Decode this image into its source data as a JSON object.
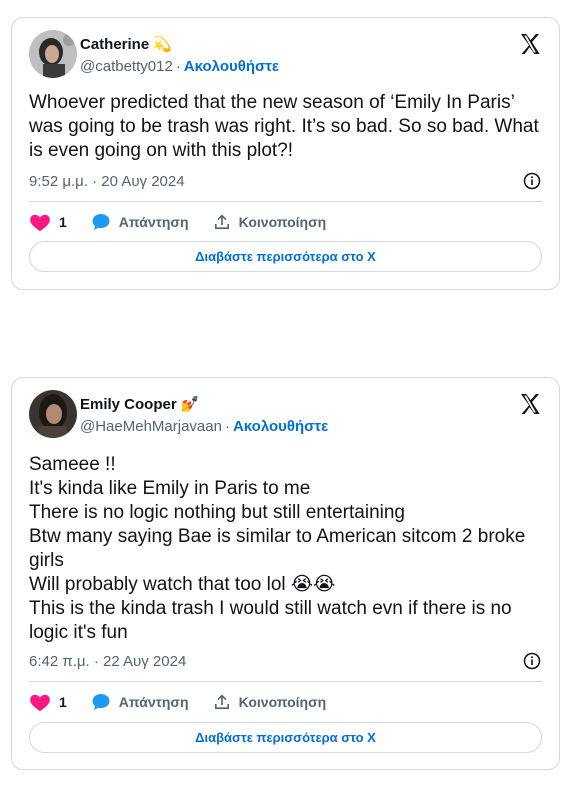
{
  "tweets": [
    {
      "name": "Catherine",
      "name_emoji": "💫",
      "handle": "@catbetty012",
      "follow_label": "Ακολουθήστε",
      "text": "Whoever predicted that the new season of ‘Emily In Paris’ was going to be trash was right. It’s so bad. So so bad. What is even going on with this plot?!",
      "timestamp": "9:52 μ.μ. · 20 Αυγ 2024",
      "like_count": "1",
      "reply_label": "Απάντηση",
      "share_label": "Κοινοποίηση",
      "read_more_label": "Διαβάστε περισσότερα στο X"
    },
    {
      "name": "Emily Cooper",
      "name_emoji": "💅",
      "handle": "@HaeMehMarjavaan",
      "follow_label": "Ακολουθήστε",
      "text": "Sameee !!\nIt's kinda like Emily in Paris to me\nThere is no logic nothing but still entertaining\nBtw many saying Bae is similar to American sitcom 2 broke girls\nWill probably watch that too lol 😭😭\nThis is the kinda trash I would still watch evn if there is no logic it's fun",
      "timestamp": "6:42 π.μ. · 22 Αυγ 2024",
      "like_count": "1",
      "reply_label": "Απάντηση",
      "share_label": "Κοινοποίηση",
      "read_more_label": "Διαβάστε περισσότερα στο X"
    }
  ],
  "colors": {
    "accent": "#006fd6",
    "like": "#f91880",
    "muted": "#536471",
    "border": "#cfd9de"
  }
}
